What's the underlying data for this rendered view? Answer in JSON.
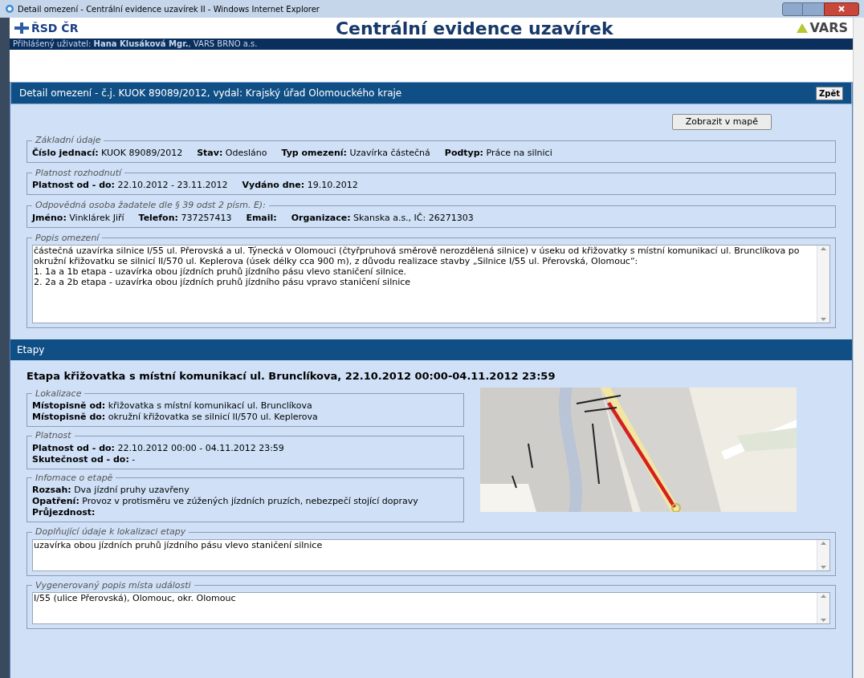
{
  "window": {
    "title": "Detail omezení - Centrální evidence uzavírek II - Windows Internet Explorer"
  },
  "header": {
    "logo_left": "ŘSD ČR",
    "title": "Centrální evidence uzavírek",
    "logo_right": "VARS"
  },
  "user_bar": {
    "text": "Přihlášený uživatel: **Hana Klusáková Mgr.**, VARS BRNO a.s."
  },
  "detail": {
    "title": "Detail omezení - č.j. KUOK 89089/2012, vydal: Krajský úřad Olomouckého kraje",
    "back_button": "Zpět",
    "map_button": "Zobrazit v mapě",
    "groups": [
      {
        "legend": "Základní údaje",
        "fields": [
          "**Číslo jednací:** KUOK 89089/2012",
          "**Stav:** Odesláno",
          "**Typ omezení:** Uzavírka částečná",
          "**Podtyp:** Práce na silnici"
        ]
      },
      {
        "legend": "Platnost rozhodnutí",
        "fields": [
          "**Platnost od - do:** 22.10.2012 - 23.11.2012",
          "**Vydáno dne:** 19.10.2012"
        ]
      },
      {
        "legend": "Odpovědná osoba žadatele dle § 39 odst 2 písm. E):",
        "fields": [
          "**Jméno:** Vinklárek Jiří",
          "**Telefon:** 737257413",
          "**Email:**",
          "**Organizace:** Skanska a.s., IČ: 26271303"
        ]
      }
    ],
    "description": {
      "legend": "Popis omezení",
      "value": "částečná uzavírka silnice I/55 ul. Přerovská a ul. Týnecká v Olomouci (čtyřpruhová směrově nerozdělená silnice) v úseku od křižovatky s místní komunikací ul. Brunclíkova po okružní křižovatku se silnicí II/570 ul. Keplerova (úsek délky cca 900 m), z důvodu realizace stavby „Silnice I/55 ul. Přerovská, Olomouc“:\n1. 1a a 1b etapa - uzavírka obou jízdních pruhů jízdního pásu vlevo staničení silnice.\n2. 2a a 2b etapa - uzavírka obou jízdních pruhů jízdního pásu vpravo staničení silnice"
    }
  },
  "stages": {
    "header": "Etapy",
    "title": "Etapa křižovatka s místní komunikací ul. Brunclíkova, 22.10.2012 00:00-04.11.2012 23:59",
    "groups": [
      {
        "legend": "Lokalizace",
        "fields": [
          "**Místopisně od:** křižovatka s místní komunikací ul. Brunclíkova",
          "**Místopisně do:** okružní křižovatka se silnicí II/570 ul. Keplerova"
        ]
      },
      {
        "legend": "Platnost",
        "fields": [
          "**Platnost od - do:** 22.10.2012 00:00 - 04.11.2012 23:59",
          "**Skutečnost od - do:** -"
        ]
      },
      {
        "legend": "Infomace o etapě",
        "fields": [
          "**Rozsah:** Dva jízdní pruhy uzavřeny",
          "**Opatření:** Provoz v protisměru ve zúžených jízdních pruzích, nebezpečí stojící dopravy",
          "**Průjezdnost:**"
        ]
      }
    ],
    "notes": [
      {
        "legend": "Doplňující údaje k lokalizaci etapy",
        "value": "uzavírka obou jízdních pruhů jízdního pásu vlevo staničení silnice"
      },
      {
        "legend": "Vygenerovaný popis místa události",
        "value": "I/55 (ulice Přerovská), Olomouc, okr. Olomouc"
      }
    ]
  }
}
